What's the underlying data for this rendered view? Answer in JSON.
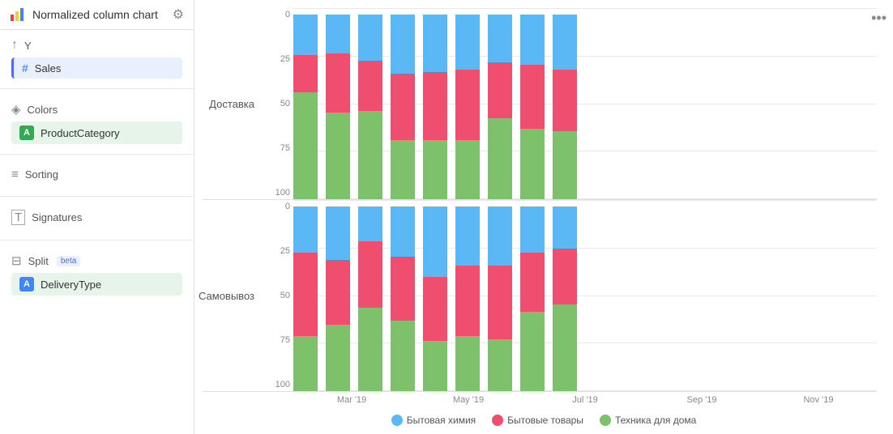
{
  "header": {
    "title": "Normalized column chart",
    "icon": "chart-icon",
    "gear_label": "⚙"
  },
  "sidebar": {
    "sections": [
      {
        "id": "y-axis",
        "icon": "↑",
        "label": "Y",
        "fields": [
          {
            "id": "sales",
            "badge": "#",
            "badge_type": "hash",
            "name": "Sales",
            "active": true
          }
        ]
      },
      {
        "id": "colors",
        "icon": "◈",
        "label": "Colors",
        "fields": [
          {
            "id": "product-category",
            "badge": "A",
            "badge_type": "green",
            "name": "ProductCategory",
            "active": false
          }
        ]
      },
      {
        "id": "sorting",
        "icon": "≡",
        "label": "Sorting",
        "fields": []
      },
      {
        "id": "signatures",
        "icon": "T",
        "label": "Signatures",
        "fields": []
      },
      {
        "id": "split",
        "icon": "⊟",
        "label": "Split",
        "beta": "beta",
        "fields": [
          {
            "id": "delivery-type",
            "badge": "A",
            "badge_type": "blue",
            "name": "DeliveryType",
            "active": false
          }
        ]
      }
    ]
  },
  "chart": {
    "more_icon": "•••",
    "rows": [
      {
        "id": "доставка",
        "label": "Доставка",
        "bars": [
          {
            "green": 58,
            "red": 20,
            "blue": 22
          },
          {
            "green": 47,
            "red": 32,
            "blue": 21
          },
          {
            "green": 48,
            "red": 27,
            "blue": 25
          },
          {
            "green": 32,
            "red": 36,
            "blue": 32
          },
          {
            "green": 32,
            "red": 37,
            "blue": 31
          },
          {
            "green": 32,
            "red": 38,
            "blue": 30
          },
          {
            "green": 44,
            "red": 30,
            "blue": 26
          },
          {
            "green": 38,
            "red": 35,
            "blue": 27
          },
          {
            "green": 37,
            "red": 33,
            "blue": 30
          }
        ]
      },
      {
        "id": "самовывоз",
        "label": "Самовывоз",
        "bars": [
          {
            "green": 30,
            "red": 45,
            "blue": 25
          },
          {
            "green": 36,
            "red": 35,
            "blue": 29
          },
          {
            "green": 45,
            "red": 36,
            "blue": 19
          },
          {
            "green": 38,
            "red": 35,
            "blue": 27
          },
          {
            "green": 27,
            "red": 35,
            "blue": 38
          },
          {
            "green": 30,
            "red": 38,
            "blue": 32
          },
          {
            "green": 28,
            "red": 40,
            "blue": 32
          },
          {
            "green": 43,
            "red": 32,
            "blue": 25
          },
          {
            "green": 47,
            "red": 30,
            "blue": 23
          }
        ]
      }
    ],
    "x_ticks": [
      "Mar '19",
      "May '19",
      "Jul '19",
      "Sep '19",
      "Nov '19"
    ],
    "y_ticks": [
      "0",
      "25",
      "50",
      "75",
      "100"
    ],
    "legend": [
      {
        "id": "bytovaya-himiya",
        "color": "#5bb8f5",
        "label": "Бытовая химия"
      },
      {
        "id": "bytovye-tovary",
        "color": "#f04e6e",
        "label": "Бытовые товары"
      },
      {
        "id": "tehnika",
        "color": "#7dc26b",
        "label": "Техника для дома"
      }
    ],
    "colors": {
      "blue": "#5bb8f5",
      "red": "#f04e6e",
      "green": "#7dc26b"
    }
  }
}
